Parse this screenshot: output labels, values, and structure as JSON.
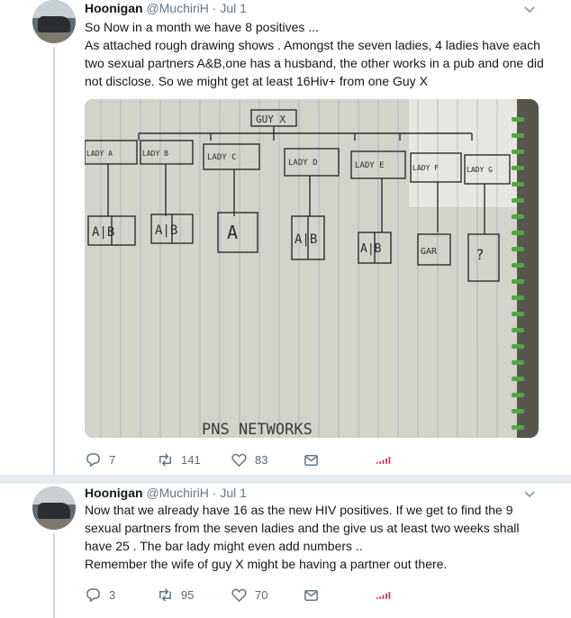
{
  "tweets": [
    {
      "name": "Hoonigan",
      "handle": "@MuchiriH",
      "time": "· Jul 1",
      "lines": [
        "So Now in a month we have 8 positives ...",
        "As attached rough drawing shows . Amongst the seven ladies, 4 ladies have each two sexual partners A&B,one  has a husband, the other works in a pub and one did not disclose. So we might get at least 16Hiv+ from one Guy X"
      ],
      "replies": "7",
      "retweets": "141",
      "likes": "83",
      "drawing": {
        "top": "GUY X",
        "ladies": [
          "LADY A",
          "LADY B",
          "LADY C",
          "LADY D",
          "LADY E",
          "LADY F",
          "LADY G"
        ],
        "partners": [
          "A|B",
          "A|B",
          "A",
          "A|B",
          "A|B",
          "GAR",
          "?"
        ],
        "footer": "PNS NETWORKS"
      }
    },
    {
      "name": "Hoonigan",
      "handle": "@MuchiriH",
      "time": "· Jul 1",
      "lines": [
        "Now that we already have 16 as the new  HIV positives. If  we get to find the 9 sexual partners from the seven ladies and the give us at least two weeks shall have 25 . The bar lady might even add numbers ..",
        "Remember the wife of guy X might be having a partner out there."
      ],
      "replies": "3",
      "retweets": "95",
      "likes": "70"
    }
  ],
  "icons": {
    "reply": "reply-icon",
    "retweet": "retweet-icon",
    "like": "heart-icon",
    "dm": "envelope-icon",
    "analytics": "analytics-icon",
    "caret": "chevron-down-icon"
  },
  "colors": {
    "text": "#14171a",
    "muted": "#657786",
    "analytics": "#e0245e",
    "thread": "#ccd6dd"
  }
}
